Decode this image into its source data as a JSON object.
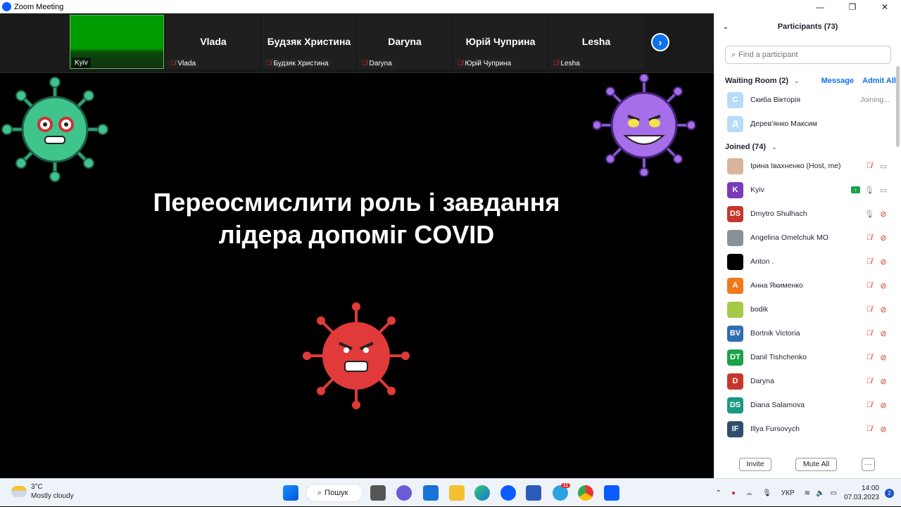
{
  "window": {
    "title": "Zoom Meeting"
  },
  "video_strip": [
    {
      "big": "",
      "name": "Kyiv",
      "muted": false
    },
    {
      "big": "Vlada",
      "name": "Vlada",
      "muted": true
    },
    {
      "big": "Будзяк Христина",
      "name": "Будзяк Христина",
      "muted": true
    },
    {
      "big": "Daryna",
      "name": "Daryna",
      "muted": true
    },
    {
      "big": "Юрій Чуприна",
      "name": "Юрій Чуприна",
      "muted": true
    },
    {
      "big": "Lesha",
      "name": "Lesha",
      "muted": true
    }
  ],
  "slide": {
    "headline_line1": "Переосмислити роль і завдання",
    "headline_line2": "лідера допоміг COVID"
  },
  "panel": {
    "title": "Participants (73)",
    "search_placeholder": "Find a participant",
    "waiting_label": "Waiting Room (2)",
    "message_link": "Message",
    "admit_all_link": "Admit All",
    "waiting": [
      {
        "initial": "С",
        "name": "Скиба Вікторія",
        "status": "Joining...",
        "color": "#b8dcf7"
      },
      {
        "initial": "Д",
        "name": "Дерев'янко Максим",
        "status": "",
        "color": "#b8dcf7"
      }
    ],
    "joined_label": "Joined (74)",
    "joined": [
      {
        "initial": "",
        "name": "Ірина Івахненко (Host, me)",
        "color": "#d8b59a",
        "mic": "off",
        "video": "on"
      },
      {
        "initial": "K",
        "name": "Kyiv",
        "color": "#7b3ab8",
        "mic": "on",
        "video": "on",
        "sharing": true
      },
      {
        "initial": "DS",
        "name": "Dmytro Shulhach",
        "color": "#c8372d",
        "mic": "on",
        "video": "off"
      },
      {
        "initial": "",
        "name": "Angelina Omelchuk MO",
        "color": "#8a8f98",
        "mic": "off",
        "video": "off"
      },
      {
        "initial": "",
        "name": "Anton .",
        "color": "#000000",
        "mic": "off",
        "video": "off"
      },
      {
        "initial": "A",
        "name": "Анна Якименко",
        "color": "#f07a1a",
        "mic": "off",
        "video": "off"
      },
      {
        "initial": "",
        "name": "bodik",
        "color": "#a6c94a",
        "mic": "off",
        "video": "off"
      },
      {
        "initial": "BV",
        "name": "Bortnik Victoria",
        "color": "#2f6db3",
        "mic": "off",
        "video": "off"
      },
      {
        "initial": "DT",
        "name": "Danil Tishchenko",
        "color": "#1aa34a",
        "mic": "off",
        "video": "off"
      },
      {
        "initial": "D",
        "name": "Daryna",
        "color": "#c8372d",
        "mic": "off",
        "video": "off"
      },
      {
        "initial": "DS",
        "name": "Diana Salamova",
        "color": "#1a9a83",
        "mic": "off",
        "video": "off"
      },
      {
        "initial": "IF",
        "name": "Illya Fursovych",
        "color": "#2f4d6e",
        "mic": "off",
        "video": "off"
      }
    ],
    "invite_button": "Invite",
    "mute_all_button": "Mute All",
    "more_button": "···"
  },
  "taskbar": {
    "temp": "3°C",
    "weather": "Mostly cloudy",
    "search_label": "Пошук",
    "telegram_badge": "11",
    "lang": "УКР",
    "time": "14:00",
    "date": "07.03.2023",
    "notifications": "2"
  }
}
